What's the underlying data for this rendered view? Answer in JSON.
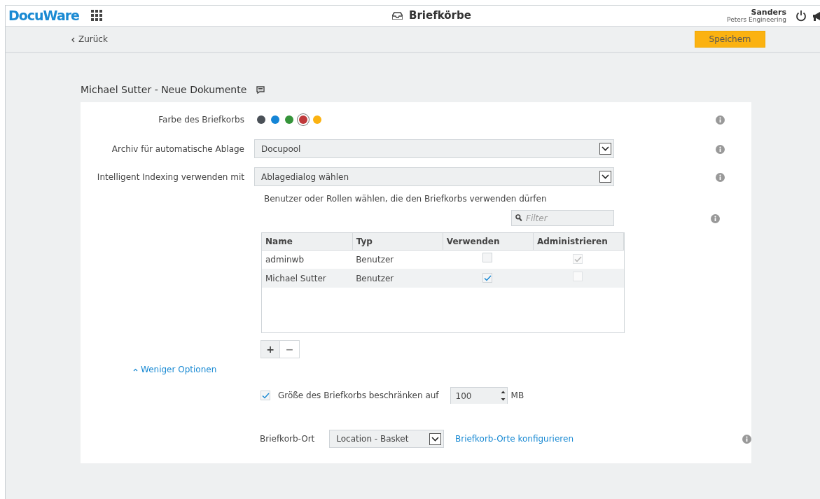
{
  "header": {
    "logo": "DocuWare",
    "title": "Briefkörbe",
    "user": "Sanders",
    "company": "Peters Engineering"
  },
  "toolbar": {
    "back": "Zurück",
    "save": "Speichern"
  },
  "basket_title": "Michael Sutter - Neue Dokumente",
  "color_field": {
    "label": "Farbe des Briefkorbs",
    "colors": [
      {
        "color": "#4a5057",
        "selected": false
      },
      {
        "color": "#1585d6",
        "selected": false
      },
      {
        "color": "#35943a",
        "selected": false
      },
      {
        "color": "#c0393b",
        "selected": true
      },
      {
        "color": "#fbb211",
        "selected": false
      }
    ]
  },
  "archive_field": {
    "label": "Archiv für automatische Ablage",
    "value": "Docupool"
  },
  "indexing_field": {
    "label": "Intelligent Indexing verwenden mit",
    "value": "Ablagedialog wählen"
  },
  "users_hint": "Benutzer oder Rollen wählen, die den Briefkorbs verwenden dürfen",
  "filter": {
    "placeholder": "Filter"
  },
  "table": {
    "columns": [
      "Name",
      "Typ",
      "Verwenden",
      "Administrieren"
    ],
    "rows": [
      {
        "name": "adminwb",
        "type": "Benutzer",
        "use": {
          "checked": false,
          "disabled": false
        },
        "admin": {
          "checked": true,
          "disabled": true
        },
        "selected": false
      },
      {
        "name": "Michael Sutter",
        "type": "Benutzer",
        "use": {
          "checked": true,
          "disabled": false
        },
        "admin": {
          "checked": false,
          "disabled": true
        },
        "selected": true
      }
    ]
  },
  "table_buttons": [
    "+",
    "−"
  ],
  "less_options": "Weniger Optionen",
  "limit": {
    "checked": true,
    "label": "Größe des Briefkorbs beschränken auf",
    "value": "100",
    "unit": "MB"
  },
  "location": {
    "label": "Briefkorb-Ort",
    "value": "Location - Basket",
    "link": "Briefkorb-Orte konfigurieren"
  }
}
